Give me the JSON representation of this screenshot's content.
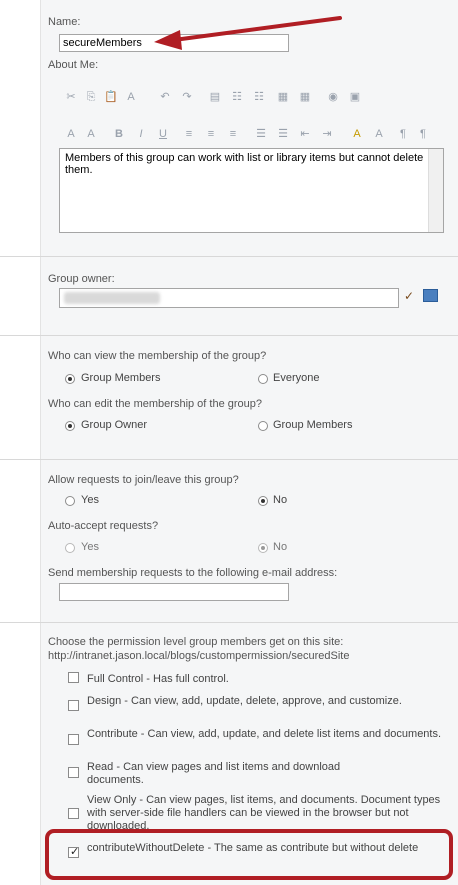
{
  "name": {
    "label": "Name:",
    "value": "secureMembers"
  },
  "about": {
    "label": "About Me:",
    "text": "Members of this group can work with list or library items but cannot delete them.",
    "toolbar_row1": [
      "✂",
      "⎘",
      "📋",
      "A",
      "↶",
      "↷",
      "▤",
      "☷",
      "☷",
      "▦",
      "▦",
      "◉",
      "▣"
    ],
    "toolbar_row2": [
      "A",
      "A",
      "B",
      "I",
      "U",
      "≡",
      "≡",
      "≡",
      "☰",
      "☰",
      "⇤",
      "⇥",
      "A",
      "A",
      "¶",
      "¶"
    ]
  },
  "owner": {
    "label": "Group owner:",
    "value": ""
  },
  "view_membership": {
    "label": "Who can view the membership of the group?",
    "opt1": "Group Members",
    "opt2": "Everyone"
  },
  "edit_membership": {
    "label": "Who can edit the membership of the group?",
    "opt1": "Group Owner",
    "opt2": "Group Members"
  },
  "requests": {
    "label": "Allow requests to join/leave this group?",
    "yes": "Yes",
    "no": "No"
  },
  "auto_accept": {
    "label": "Auto-accept requests?",
    "yes": "Yes",
    "no": "No"
  },
  "email": {
    "label": "Send membership requests to the following e-mail address:",
    "value": ""
  },
  "permissions": {
    "intro": "Choose the permission level group members get on this site:",
    "site_url": "http://intranet.jason.local/blogs/custompermission/securedSite",
    "items": [
      "Full Control - Has full control.",
      "Design - Can view, add, update, delete, approve, and customize.",
      "Contribute - Can view, add, update, and delete list items and documents.",
      "Read - Can view pages and list items and download documents.",
      "View Only - Can view pages, list items, and documents. Document types with server-side file handlers can be viewed in the browser but not downloaded.",
      "contributeWithoutDelete - The same as contribute but without delete"
    ]
  },
  "colors": {
    "annotation": "#b01e24",
    "panel": "#f5f6f7"
  }
}
